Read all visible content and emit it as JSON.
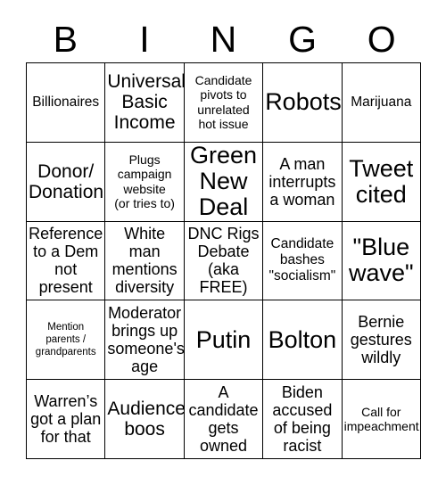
{
  "card": {
    "title_letters": [
      "B",
      "I",
      "N",
      "G",
      "O"
    ],
    "columns": 5,
    "rows": 5,
    "border_color": "#000000",
    "background_color": "#ffffff",
    "text_color": "#000000",
    "cells": [
      {
        "text": "Billionaires",
        "size": "sm"
      },
      {
        "text": "Universal\nBasic\nIncome",
        "size": "lg"
      },
      {
        "text": "Candidate\npivots to\nunrelated\nhot issue",
        "size": "xs"
      },
      {
        "text": "Robots",
        "size": "xxl"
      },
      {
        "text": "Marijuana",
        "size": "sm"
      },
      {
        "text": "Donor/\nDonation",
        "size": "lg"
      },
      {
        "text": "Plugs\ncampaign\nwebsite\n(or tries to)",
        "size": "xs"
      },
      {
        "text": "Green\nNew\nDeal",
        "size": "xxl"
      },
      {
        "text": "A man\ninterrupts\na woman",
        "size": "md"
      },
      {
        "text": "Tweet\ncited",
        "size": "xxl"
      },
      {
        "text": "Reference\nto a Dem\nnot\npresent",
        "size": "md"
      },
      {
        "text": "White\nman\nmentions\ndiversity",
        "size": "md"
      },
      {
        "text": "DNC Rigs\nDebate\n(aka\nFREE)",
        "size": "md"
      },
      {
        "text": "Candidate\nbashes\n\"socialism\"",
        "size": "sm"
      },
      {
        "text": "\"Blue\nwave\"",
        "size": "xxl"
      },
      {
        "text": "Mention\nparents /\ngrandparents",
        "size": "xxs"
      },
      {
        "text": "Moderator\nbrings up\nsomeone's\nage",
        "size": "md"
      },
      {
        "text": "Putin",
        "size": "xxl"
      },
      {
        "text": "Bolton",
        "size": "xxl"
      },
      {
        "text": "Bernie\ngestures\nwildly",
        "size": "md"
      },
      {
        "text": "Warren’s\ngot a plan\nfor that",
        "size": "md"
      },
      {
        "text": "Audience\nboos",
        "size": "lg"
      },
      {
        "text": "A\ncandidate\ngets\nowned",
        "size": "md"
      },
      {
        "text": "Biden\naccused\nof being\nracist",
        "size": "md"
      },
      {
        "text": "Call for\nimpeachment",
        "size": "xs"
      }
    ]
  }
}
